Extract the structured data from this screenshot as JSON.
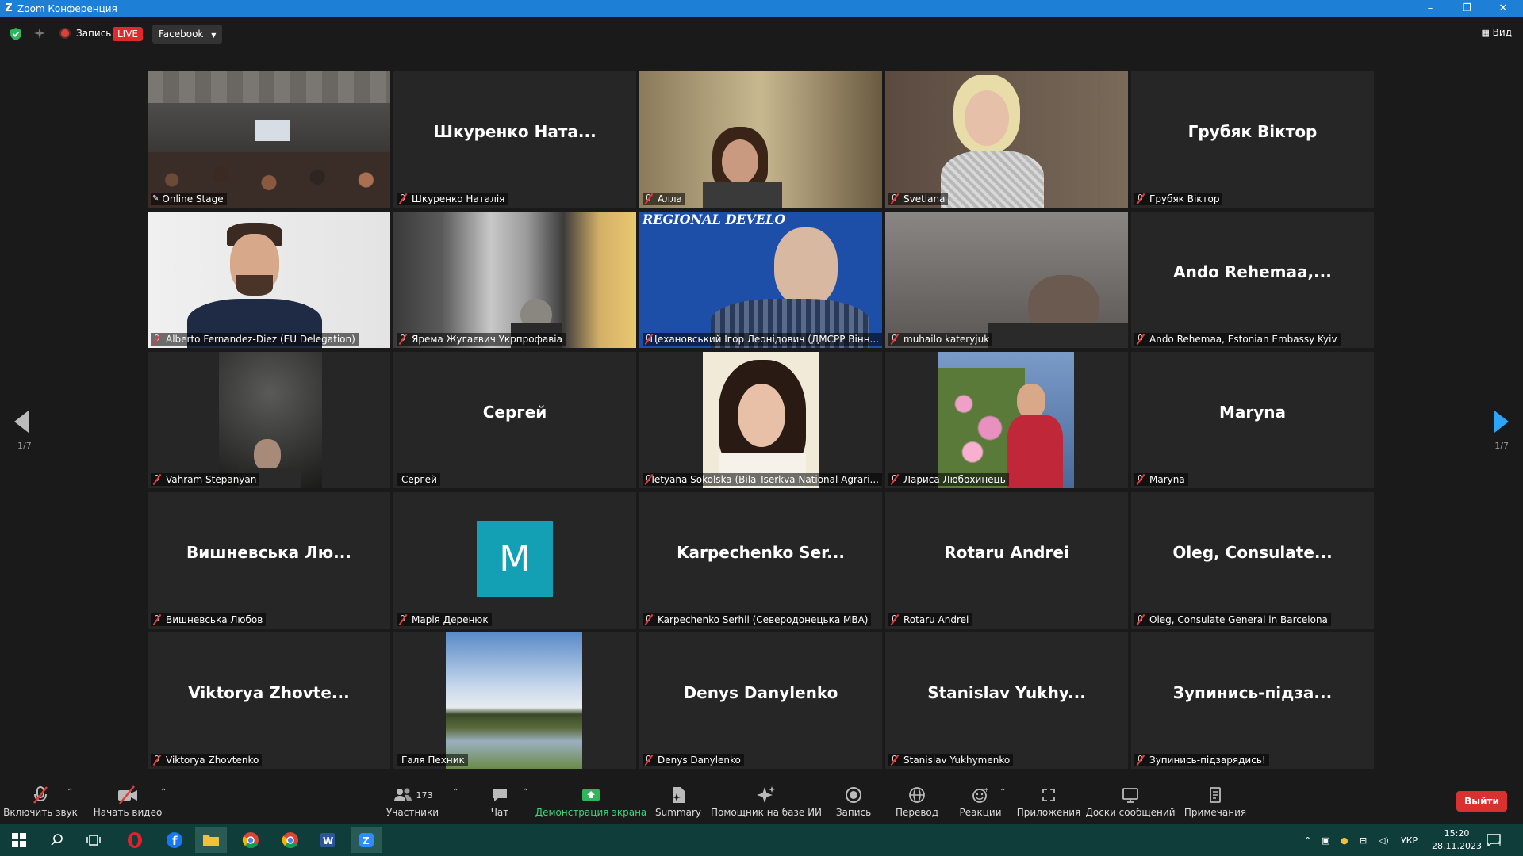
{
  "window": {
    "title": "Zoom Конференция",
    "minimize": "–",
    "restore": "❐",
    "close": "✕"
  },
  "topbar": {
    "record_label": "Запись",
    "live_badge": "LIVE",
    "stream_target": "Facebook",
    "view_label": "Вид"
  },
  "colors": {
    "accent": "#1e7fd6",
    "active_speaker_border": "#c9e03a",
    "live_red": "#e02a2a",
    "share_green": "#3fd47a",
    "exit_red": "#d93030",
    "avatar_teal": "#14a0b4",
    "taskbar": "#0f3d3a"
  },
  "pagination": {
    "left": "1/7",
    "right": "1/7"
  },
  "participants": [
    {
      "display": "",
      "name": "Online Stage",
      "video": "room",
      "muted": false,
      "pinned": true
    },
    {
      "display": "Шкуренко  Ната...",
      "name": "Шкуренко Наталія",
      "video": "",
      "muted": true
    },
    {
      "display": "",
      "name": "Алла",
      "video": "woman-dark",
      "muted": true
    },
    {
      "display": "",
      "name": "Svetlana",
      "video": "woman-blonde",
      "muted": true
    },
    {
      "display": "Грубяк Віктор",
      "name": "Грубяк Віктор",
      "video": "",
      "muted": true
    },
    {
      "display": "",
      "name": "Alberto Fernandez-Diez (EU Delegation)",
      "video": "man-suit",
      "muted": true
    },
    {
      "display": "",
      "name": "Ярема Жугаєвич Укрпрофавіа",
      "video": "blur",
      "muted": true
    },
    {
      "display": "",
      "name": "Цехановський Ігор Леонідович (ДМСРР Вінн...",
      "video": "man-blue",
      "muted": true,
      "overlay_text": "REGIONAL DEVELO"
    },
    {
      "display": "",
      "name": "muhailo kateryjuk",
      "video": "man-headset",
      "muted": true
    },
    {
      "display": "Ando  Rehemaa,...",
      "name": "Ando Rehemaa, Estonian Embassy Kyiv",
      "video": "",
      "muted": true
    },
    {
      "display": "",
      "name": "Vahram Stepanyan",
      "video": "man-dark",
      "muted": true
    },
    {
      "display": "Сергей",
      "name": "Сергей",
      "video": "",
      "muted": false
    },
    {
      "display": "",
      "name": "Tetyana Sokolska (Bila Tserkva National Agrari...",
      "video": "woman-photo",
      "muted": true
    },
    {
      "display": "",
      "name": "Лариса Любохинець",
      "video": "woman-flowers",
      "muted": true
    },
    {
      "display": "Maryna",
      "name": "Maryna",
      "video": "",
      "muted": true
    },
    {
      "display": "Вишневська  Лю...",
      "name": "Вишневська Любов",
      "video": "",
      "muted": true
    },
    {
      "display": "",
      "name": "Марія Деренюк",
      "video": "avatar",
      "avatar_letter": "M",
      "muted": true
    },
    {
      "display": "Karpechenko  Ser...",
      "name": "Karpechenko Serhii (Северодонецька МВА)",
      "video": "",
      "muted": true
    },
    {
      "display": "Rotaru Andrei",
      "name": "Rotaru Andrei",
      "video": "",
      "muted": true
    },
    {
      "display": "Oleg,  Consulate...",
      "name": "Oleg, Consulate General in Barcelona",
      "video": "",
      "muted": true
    },
    {
      "display": "Viktorya  Zhovte...",
      "name": "Viktorya Zhovtenko",
      "video": "",
      "muted": true
    },
    {
      "display": "",
      "name": "Галя Пехник",
      "video": "landscape",
      "muted": false
    },
    {
      "display": "Denys Danylenko",
      "name": "Denys Danylenko",
      "video": "",
      "muted": true
    },
    {
      "display": "Stanislav  Yukhy...",
      "name": "Stanislav Yukhymenko",
      "video": "",
      "muted": true
    },
    {
      "display": "Зупинись-підза...",
      "name": "Зупинись-підзарядись!",
      "video": "",
      "muted": true
    }
  ],
  "toolbar": {
    "audio": "Включить звук",
    "video": "Начать видео",
    "participants": "Участники",
    "participants_count": "173",
    "chat": "Чат",
    "share": "Демонстрация экрана",
    "summary": "Summary",
    "ai": "Помощник на базе ИИ",
    "record": "Запись",
    "translate": "Перевод",
    "reactions": "Реакции",
    "apps": "Приложения",
    "whiteboards": "Доски сообщений",
    "notes": "Примечания",
    "leave": "Выйти"
  },
  "taskbar": {
    "lang": "УКР",
    "time": "15:20",
    "date": "28.11.2023",
    "notifications": "1"
  }
}
